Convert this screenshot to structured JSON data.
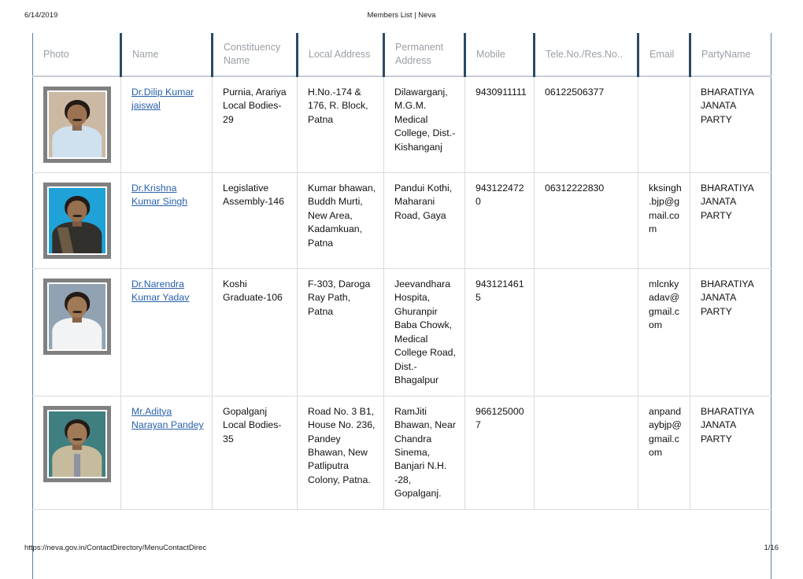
{
  "header": {
    "date": "6/14/2019",
    "title": "Members List | Neva"
  },
  "footer": {
    "url": "https://neva.gov.in/ContactDirectory/MenuContactDirec",
    "page": "1/16"
  },
  "table": {
    "columns": [
      "Photo",
      "Name",
      "Constituency Name",
      "Local Address",
      "Permanent Address",
      "Mobile",
      "Tele.No./Res.No..",
      "Email",
      "PartyName"
    ],
    "rows": [
      {
        "photo_alt": "member-photo-dilip-kumar-jaiswal",
        "name": "Dr.Dilip Kumar jaiswal",
        "constituency": "Purnia, Arariya Local Bodies-29",
        "local_address": "H.No.-174 & 176, R. Block, Patna",
        "permanent_address": "Dilawarganj, M.G.M. Medical College, Dist.-Kishanganj",
        "mobile": "9430911111",
        "tele": "06122506377",
        "email": "",
        "party": "BHARATIYA JANATA PARTY"
      },
      {
        "photo_alt": "member-photo-krishna-kumar-singh",
        "name": "Dr.Krishna Kumar Singh",
        "constituency": "Legislative Assembly-146",
        "local_address": "Kumar bhawan, Buddh Murti, New Area, Kadamkuan, Patna",
        "permanent_address": "Pandui Kothi, Maharani Road, Gaya",
        "mobile": "9431224720",
        "tele": "06312222830",
        "email": "kksingh.bjp@gmail.com",
        "party": "BHARATIYA JANATA PARTY"
      },
      {
        "photo_alt": "member-photo-narendra-kumar-yadav",
        "name": "Dr.Narendra Kumar Yadav",
        "constituency": "Koshi Graduate-106",
        "local_address": "F-303, Daroga Ray Path, Patna",
        "permanent_address": "Jeevandhara Hospita, Ghuranpir Baba Chowk, Medical College Road, Dist.-Bhagalpur",
        "mobile": "9431214615",
        "tele": "",
        "email": "mlcnkyadav@gmail.com",
        "party": "BHARATIYA JANATA PARTY"
      },
      {
        "photo_alt": "member-photo-aditya-narayan-pandey",
        "name": "Mr.Aditya Narayan Pandey",
        "constituency": "Gopalganj Local Bodies-35",
        "local_address": "Road No. 3 B1, House No. 236, Pandey Bhawan, New Patliputra Colony, Patna.",
        "permanent_address": "RamJiti Bhawan, Near Chandra Sinema, Banjari N.H. -28, Gopalganj.",
        "mobile": "9661250007",
        "tele": "",
        "email": "anpandaybjp@gmail.com",
        "party": "BHARATIYA JANATA PARTY"
      }
    ]
  },
  "colors": {
    "link": "#2a61ad",
    "header_text": "#9aa0a6",
    "header_divider": "#2b4a63",
    "cell_border": "#d7dbdf",
    "table_outer_border": "#5b7fa0"
  }
}
